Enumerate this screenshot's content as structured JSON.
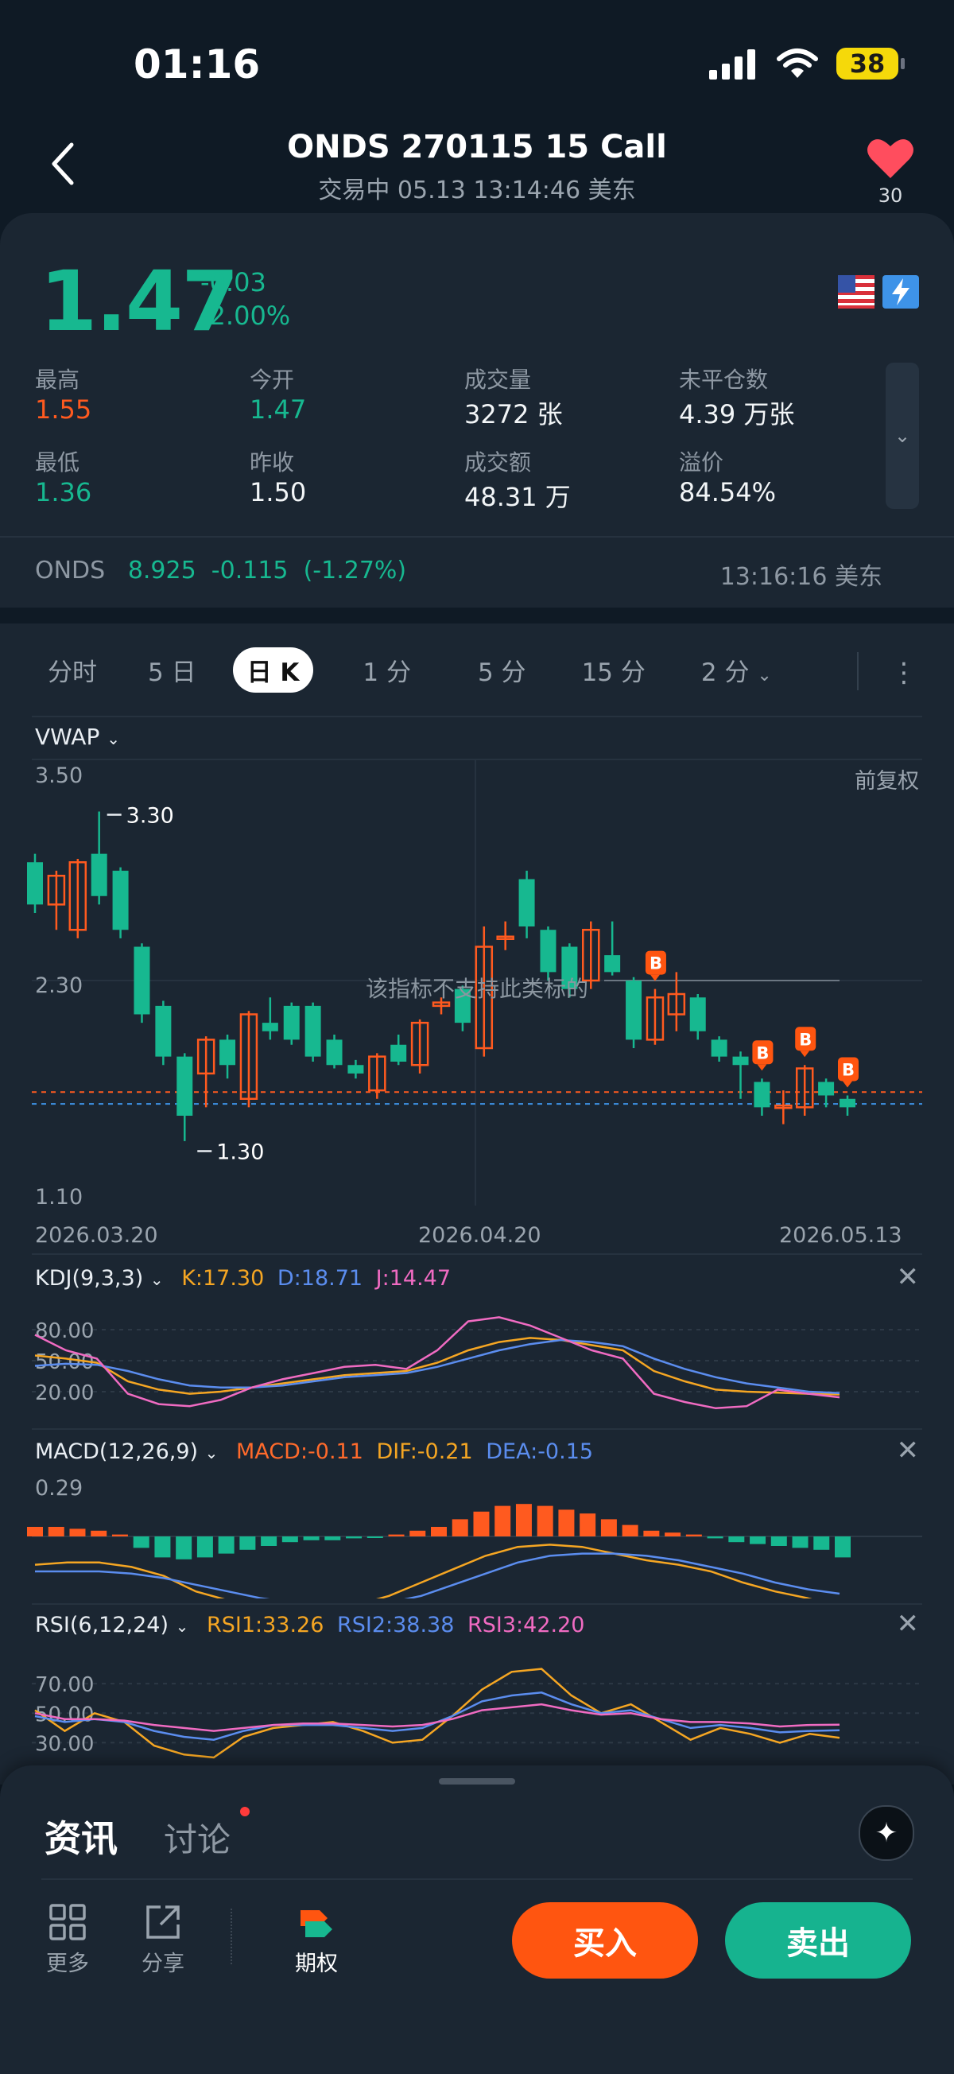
{
  "status": {
    "time": "01:16",
    "battery": "38"
  },
  "header": {
    "title": "ONDS 270115 15 Call",
    "subtitle": "交易中 05.13 13:14:46 美东",
    "fav_count": "30"
  },
  "quote": {
    "price": "1.47",
    "change": "-0.03",
    "change_pct": "-2.00%",
    "stats": [
      {
        "label": "最高",
        "value": "1.55"
      },
      {
        "label": "今开",
        "value": "1.47"
      },
      {
        "label": "成交量",
        "value": "3272 张"
      },
      {
        "label": "未平仓数",
        "value": "4.39 万张"
      },
      {
        "label": "最低",
        "value": "1.36"
      },
      {
        "label": "昨收",
        "value": "1.50"
      },
      {
        "label": "成交额",
        "value": "48.31 万"
      },
      {
        "label": "溢价",
        "value": "84.54%"
      }
    ],
    "underlying": {
      "symbol": "ONDS",
      "price": "8.925",
      "change": "-0.115",
      "change_pct": "(-1.27%)",
      "time": "13:16:16 美东"
    }
  },
  "tabs": [
    "分时",
    "5 日",
    "日 K",
    "1 分",
    "5 分",
    "15 分",
    "2 分"
  ],
  "active_tab": 2,
  "colors": {
    "up": "#ff5a1f",
    "down": "#17b890",
    "k": "#f5a623",
    "d": "#5b8def",
    "j": "#f06bc2"
  },
  "chart_labels": {
    "vwap": "VWAP",
    "adjust": "前复权",
    "notice": "该指标不支持此类标的",
    "y_top": "3.50",
    "y_mid": "2.30",
    "y_bottom": "1.10",
    "high_mark": "3.30",
    "low_mark": "1.30",
    "dates": [
      "2026.03.20",
      "2026.04.20",
      "2026.05.13"
    ],
    "b_marker": "B"
  },
  "chart_data": [
    {
      "type": "candlestick",
      "title": "",
      "ylim": [
        1.1,
        3.5
      ],
      "x_labels": [
        "2026.03.20",
        "2026.04.20",
        "2026.05.13"
      ],
      "candles": [
        {
          "o": 3.0,
          "c": 2.75,
          "h": 3.05,
          "l": 2.7
        },
        {
          "o": 2.75,
          "c": 2.92,
          "h": 2.95,
          "l": 2.6
        },
        {
          "o": 2.6,
          "c": 3.0,
          "h": 3.02,
          "l": 2.55
        },
        {
          "o": 3.05,
          "c": 2.8,
          "h": 3.3,
          "l": 2.75
        },
        {
          "o": 2.95,
          "c": 2.6,
          "h": 2.97,
          "l": 2.55
        },
        {
          "o": 2.5,
          "c": 2.1,
          "h": 2.52,
          "l": 2.05
        },
        {
          "o": 2.15,
          "c": 1.85,
          "h": 2.18,
          "l": 1.8
        },
        {
          "o": 1.85,
          "c": 1.5,
          "h": 1.87,
          "l": 1.35
        },
        {
          "o": 1.75,
          "c": 1.95,
          "h": 1.97,
          "l": 1.55
        },
        {
          "o": 1.95,
          "c": 1.8,
          "h": 1.98,
          "l": 1.72
        },
        {
          "o": 1.6,
          "c": 2.1,
          "h": 2.12,
          "l": 1.55
        },
        {
          "o": 2.05,
          "c": 2.0,
          "h": 2.2,
          "l": 1.95
        },
        {
          "o": 2.15,
          "c": 1.95,
          "h": 2.17,
          "l": 1.92
        },
        {
          "o": 2.15,
          "c": 1.85,
          "h": 2.17,
          "l": 1.82
        },
        {
          "o": 1.95,
          "c": 1.8,
          "h": 1.98,
          "l": 1.78
        },
        {
          "o": 1.8,
          "c": 1.75,
          "h": 1.83,
          "l": 1.72
        },
        {
          "o": 1.65,
          "c": 1.85,
          "h": 1.87,
          "l": 1.6
        },
        {
          "o": 1.92,
          "c": 1.82,
          "h": 1.98,
          "l": 1.8
        },
        {
          "o": 1.8,
          "c": 2.05,
          "h": 2.07,
          "l": 1.75
        },
        {
          "o": 2.15,
          "c": 2.17,
          "h": 2.2,
          "l": 2.1
        },
        {
          "o": 2.25,
          "c": 2.05,
          "h": 2.27,
          "l": 2.0
        },
        {
          "o": 1.9,
          "c": 2.5,
          "h": 2.62,
          "l": 1.85
        },
        {
          "o": 2.55,
          "c": 2.56,
          "h": 2.65,
          "l": 2.48
        },
        {
          "o": 2.9,
          "c": 2.62,
          "h": 2.95,
          "l": 2.55
        },
        {
          "o": 2.6,
          "c": 2.35,
          "h": 2.62,
          "l": 2.3
        },
        {
          "o": 2.5,
          "c": 2.25,
          "h": 2.52,
          "l": 2.2
        },
        {
          "o": 2.3,
          "c": 2.6,
          "h": 2.65,
          "l": 2.25
        },
        {
          "o": 2.45,
          "c": 2.35,
          "h": 2.65,
          "l": 2.33
        },
        {
          "o": 2.3,
          "c": 1.95,
          "h": 2.32,
          "l": 1.9
        },
        {
          "o": 1.95,
          "c": 2.2,
          "h": 2.25,
          "l": 1.92
        },
        {
          "o": 2.1,
          "c": 2.22,
          "h": 2.35,
          "l": 2.0
        },
        {
          "o": 2.2,
          "c": 2.0,
          "h": 2.22,
          "l": 1.95
        },
        {
          "o": 1.95,
          "c": 1.85,
          "h": 1.97,
          "l": 1.82
        },
        {
          "o": 1.85,
          "c": 1.8,
          "h": 1.88,
          "l": 1.6
        },
        {
          "o": 1.7,
          "c": 1.55,
          "h": 1.72,
          "l": 1.5
        },
        {
          "o": 1.55,
          "c": 1.56,
          "h": 1.65,
          "l": 1.45
        },
        {
          "o": 1.55,
          "c": 1.78,
          "h": 1.8,
          "l": 1.5
        },
        {
          "o": 1.7,
          "c": 1.62,
          "h": 1.72,
          "l": 1.55
        },
        {
          "o": 1.6,
          "c": 1.55,
          "h": 1.62,
          "l": 1.5
        }
      ],
      "reference_lines": [
        1.64,
        1.57
      ]
    },
    {
      "type": "line",
      "title": "KDJ(9,3,3)",
      "ylim": [
        0,
        100
      ],
      "y_ticks": [
        "80.00",
        "50.00",
        "20.00"
      ],
      "y_tick_values": [
        80,
        50,
        20
      ],
      "series": [
        {
          "name": "K:17.30",
          "color": "#f5a623",
          "values": [
            55,
            52,
            48,
            30,
            22,
            18,
            20,
            24,
            28,
            32,
            36,
            38,
            40,
            48,
            60,
            68,
            72,
            70,
            65,
            60,
            40,
            30,
            22,
            20,
            19,
            18,
            17.3
          ]
        },
        {
          "name": "D:18.71",
          "color": "#5b8def",
          "values": [
            45,
            47,
            46,
            40,
            32,
            26,
            24,
            24,
            26,
            30,
            34,
            36,
            38,
            44,
            52,
            60,
            66,
            70,
            68,
            64,
            52,
            42,
            34,
            28,
            24,
            20,
            18.7
          ]
        },
        {
          "name": "J:14.47",
          "color": "#f06bc2",
          "values": [
            75,
            60,
            52,
            18,
            8,
            6,
            12,
            24,
            32,
            38,
            44,
            46,
            42,
            60,
            88,
            92,
            84,
            72,
            60,
            52,
            18,
            10,
            4,
            6,
            22,
            18,
            14.5
          ]
        }
      ]
    },
    {
      "type": "bar+line",
      "title": "MACD(12,26,9)",
      "y_ticks": [
        "0.29"
      ],
      "histogram": [
        0.05,
        0.05,
        0.04,
        0.03,
        0.01,
        -0.06,
        -0.11,
        -0.12,
        -0.11,
        -0.09,
        -0.07,
        -0.05,
        -0.03,
        -0.02,
        -0.02,
        -0.01,
        -0.005,
        0.01,
        0.03,
        0.05,
        0.09,
        0.13,
        0.16,
        0.17,
        0.16,
        0.14,
        0.12,
        0.09,
        0.06,
        0.03,
        0.02,
        0.01,
        -0.01,
        -0.03,
        -0.04,
        -0.05,
        -0.06,
        -0.07,
        -0.11
      ],
      "series": [
        {
          "name": "DIF:-0.21",
          "color": "#f5a623",
          "values": [
            -0.02,
            -0.01,
            -0.01,
            -0.03,
            -0.07,
            -0.14,
            -0.18,
            -0.2,
            -0.21,
            -0.21,
            -0.2,
            -0.16,
            -0.1,
            -0.04,
            0.02,
            0.06,
            0.07,
            0.06,
            0.03,
            0.0,
            -0.02,
            -0.05,
            -0.1,
            -0.14,
            -0.17,
            -0.21
          ]
        },
        {
          "name": "DEA:-0.15",
          "color": "#5b8def",
          "values": [
            -0.05,
            -0.05,
            -0.05,
            -0.06,
            -0.08,
            -0.11,
            -0.14,
            -0.17,
            -0.19,
            -0.2,
            -0.2,
            -0.19,
            -0.16,
            -0.11,
            -0.06,
            -0.01,
            0.02,
            0.03,
            0.03,
            0.02,
            0.0,
            -0.03,
            -0.06,
            -0.1,
            -0.13,
            -0.15
          ]
        }
      ],
      "extra_labels": {
        "macd": "MACD:-0.11"
      }
    },
    {
      "type": "line",
      "title": "RSI(6,12,24)",
      "ylim": [
        20,
        90
      ],
      "y_ticks": [
        "70.00",
        "50.00",
        "30.00"
      ],
      "y_tick_values": [
        70,
        50,
        30
      ],
      "series": [
        {
          "name": "RSI1:33.26",
          "color": "#f5a623",
          "values": [
            52,
            38,
            50,
            44,
            28,
            22,
            20,
            34,
            40,
            42,
            44,
            38,
            30,
            32,
            48,
            66,
            78,
            80,
            62,
            50,
            56,
            44,
            32,
            40,
            36,
            30,
            36,
            33.3
          ]
        },
        {
          "name": "RSI2:38.38",
          "color": "#5b8def",
          "values": [
            48,
            44,
            46,
            44,
            38,
            34,
            32,
            38,
            42,
            42,
            42,
            40,
            38,
            40,
            48,
            58,
            62,
            64,
            56,
            50,
            52,
            46,
            40,
            42,
            40,
            37,
            38,
            38.4
          ]
        },
        {
          "name": "RSI3:42.20",
          "color": "#f06bc2",
          "values": [
            50,
            46,
            46,
            45,
            42,
            40,
            38,
            40,
            42,
            43,
            43,
            42,
            41,
            42,
            46,
            52,
            54,
            56,
            52,
            49,
            50,
            46,
            44,
            44,
            43,
            41,
            42,
            42.2
          ]
        }
      ]
    }
  ],
  "bottom": {
    "news": "资讯",
    "discuss": "讨论",
    "tools": [
      {
        "label": "更多"
      },
      {
        "label": "分享"
      },
      {
        "label": "期权"
      }
    ],
    "buy": "买入",
    "sell": "卖出"
  }
}
